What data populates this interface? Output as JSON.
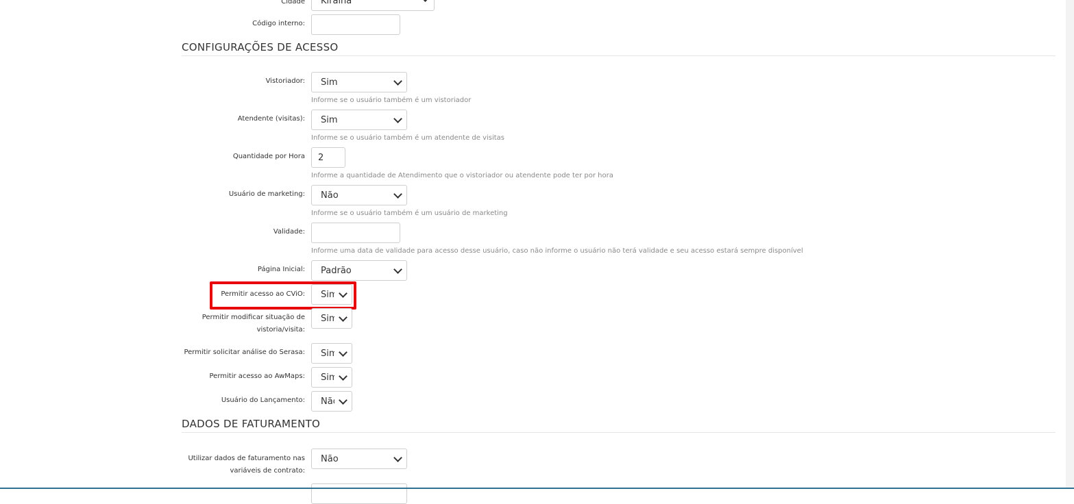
{
  "top": {
    "cidade_label": "Cidade",
    "cidade_value": "Kiraina",
    "codigo_interno_label": "Código interno:",
    "codigo_interno_value": ""
  },
  "sections": {
    "access_title": "CONFIGURAÇÕES DE ACESSO",
    "billing_title": "DADOS DE FATURAMENTO"
  },
  "fields": {
    "vistoriador": {
      "label": "Vistoriador:",
      "value": "Sim",
      "help": "Informe se o usuário também é um vistoriador"
    },
    "atendente": {
      "label": "Atendente (visitas):",
      "value": "Sim",
      "help": "Informe se o usuário também é um atendente de visitas"
    },
    "quantidade": {
      "label": "Quantidade por Hora",
      "value": "2",
      "help": "Informe a quantidade de Atendimento que o vistoriador ou atendente pode ter por hora"
    },
    "marketing": {
      "label": "Usuário de marketing:",
      "value": "Não",
      "help": "Informe se o usuário também é um usuário de marketing"
    },
    "validade": {
      "label": "Validade:",
      "value": "",
      "help": "Informe uma data de validade para acesso desse usuário, caso não informe o usuário não terá validade e seu acesso estará sempre disponível"
    },
    "pagina_inicial": {
      "label": "Página Inicial:",
      "value": "Padrão"
    },
    "cvio": {
      "label": "Permitir acesso ao CViO:",
      "value": "Sim"
    },
    "modificar_situacao": {
      "label": "Permitir modificar situação de vistoria/visita:",
      "value": "Sim"
    },
    "serasa": {
      "label": "Permitir solicitar análise do Serasa:",
      "value": "Sim"
    },
    "awmaps": {
      "label": "Permitir acesso ao AwMaps:",
      "value": "Sim"
    },
    "lancamento": {
      "label": "Usuário do Lançamento:",
      "value": "Não"
    },
    "faturamento_variaveis": {
      "label": "Utilizar dados de faturamento nas variáveis de contrato:",
      "value": "Não"
    }
  },
  "colors": {
    "highlight": "#e8000a",
    "help_text": "#8a8a8a",
    "border": "#cfcfcf"
  }
}
